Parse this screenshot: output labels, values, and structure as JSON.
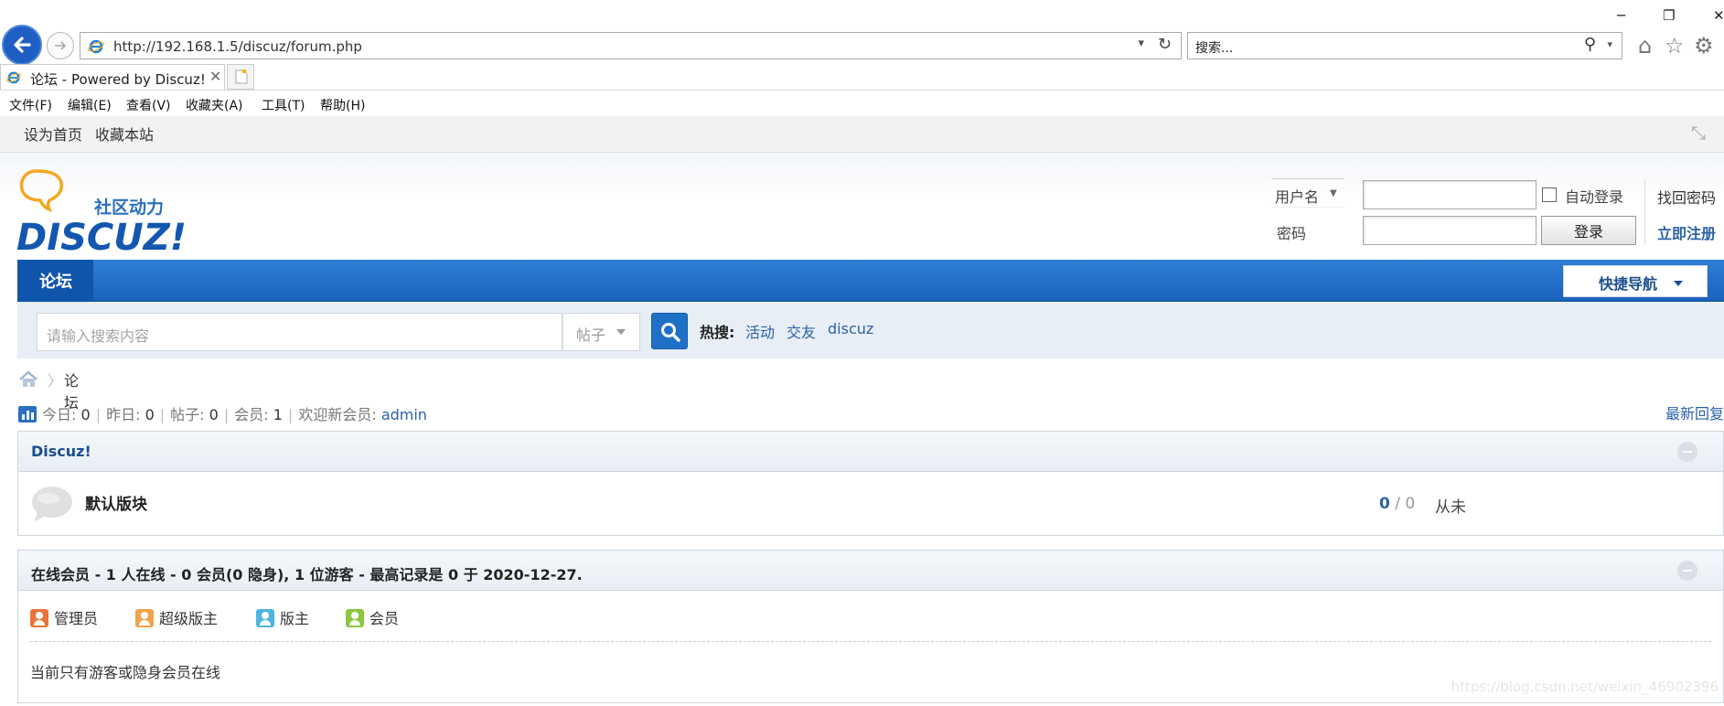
{
  "browser": {
    "url": "http://192.168.1.5/discuz/forum.php",
    "search_placeholder": "搜索...",
    "tab_title": "论坛 - Powered by Discuz!",
    "window_controls": {
      "minimize": "─",
      "restore": "❐",
      "close": "✕"
    },
    "menu": [
      "文件(F)",
      "编辑(E)",
      "查看(V)",
      "收藏夹(A)",
      "工具(T)",
      "帮助(H)"
    ]
  },
  "toolbar": {
    "set_home": "设为首页",
    "bookmark": "收藏本站"
  },
  "logo": {
    "tagline": "社区动力",
    "brand": "DISCUZ!"
  },
  "login": {
    "username_label": "用户名",
    "password_label": "密码",
    "auto_login": "自动登录",
    "login_button": "登录",
    "forgot_password": "找回密码",
    "register": "立即注册"
  },
  "nav": {
    "active": "论坛",
    "quick_nav": "快捷导航"
  },
  "search": {
    "placeholder": "请输入搜索内容",
    "type": "帖子",
    "hot_label": "热搜:",
    "hot": [
      "活动",
      "交友",
      "discuz"
    ]
  },
  "breadcrumb": {
    "current": "论坛"
  },
  "stats": {
    "today_label": "今日:",
    "today": "0",
    "yesterday_label": "昨日:",
    "yesterday": "0",
    "posts_label": "帖子:",
    "posts": "0",
    "members_label": "会员:",
    "members": "1",
    "newest_label": "欢迎新会员:",
    "newest": "admin",
    "latest_reply": "最新回复"
  },
  "forum_category": {
    "title": "Discuz!",
    "forum": {
      "name": "默认版块",
      "threads": "0",
      "sep": " / ",
      "posts": "0",
      "last": "从未"
    }
  },
  "online": {
    "title": "在线会员 - 1 人在线 - 0 会员(0 隐身), 1 位游客 - 最高记录是 0 于 2020-12-27.",
    "legend": [
      {
        "label": "管理员",
        "color": "#e8743a"
      },
      {
        "label": "超级版主",
        "color": "#f0a24a"
      },
      {
        "label": "版主",
        "color": "#4fb4e0"
      },
      {
        "label": "会员",
        "color": "#8cc63f"
      }
    ],
    "note": "当前只有游客或隐身会员在线"
  },
  "watermark": "https://blog.csdn.net/weixin_46902396"
}
